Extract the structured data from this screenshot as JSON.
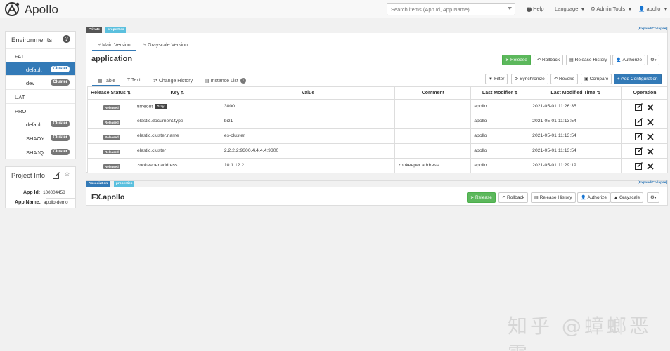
{
  "header": {
    "logo_text": "Apollo",
    "search_placeholder": "Search items (App Id, App Name)",
    "help": "Help",
    "language": "Language",
    "admin_tools": "Admin Tools",
    "user": "apollo"
  },
  "env_panel": {
    "title": "Environments",
    "items": [
      {
        "label": "FAT",
        "badge": ""
      },
      {
        "label": "default",
        "badge": "Cluster"
      },
      {
        "label": "dev",
        "badge": "Cluster"
      },
      {
        "label": "UAT",
        "badge": ""
      },
      {
        "label": "PRO",
        "badge": ""
      },
      {
        "label": "default",
        "badge": "Cluster"
      },
      {
        "label": "SHAOY",
        "badge": "Cluster"
      },
      {
        "label": "SHAJQ",
        "badge": "Cluster"
      }
    ]
  },
  "info_panel": {
    "title": "Project Info",
    "app_id_label": "App Id:",
    "app_id": "100004458",
    "app_name_label": "App Name:",
    "app_name": "apollo-demo"
  },
  "namespace1": {
    "scope_tag": "Private",
    "format_tag": "properties",
    "expand": "[Expand/Collapse]",
    "version_tabs": [
      "Main Version",
      "Grayscale Version"
    ],
    "name": "application",
    "actions": [
      "Release",
      "Rollback",
      "Release History",
      "Authorize"
    ],
    "view_tabs": [
      "Table",
      "Text",
      "Change History",
      "Instance List"
    ],
    "instance_count": "1",
    "table_actions": [
      "Filter",
      "Synchronize",
      "Revoke",
      "Compare",
      "Add Configuration"
    ],
    "columns": [
      "Release Status",
      "Key",
      "Value",
      "Comment",
      "Last Modifier",
      "Last Modified Time",
      "Operation"
    ],
    "rows": [
      {
        "status": "Released",
        "key": "timeout",
        "gray": "Gray",
        "value": "3000",
        "comment": "",
        "modifier": "apollo",
        "time": "2021-05-01 11:26:35"
      },
      {
        "status": "Released",
        "key": "elastic.document.type",
        "gray": "",
        "value": "biz1",
        "comment": "",
        "modifier": "apollo",
        "time": "2021-05-01 11:13:54"
      },
      {
        "status": "Released",
        "key": "elastic.cluster.name",
        "gray": "",
        "value": "es-cluster",
        "comment": "",
        "modifier": "apollo",
        "time": "2021-05-01 11:13:54"
      },
      {
        "status": "Released",
        "key": "elastic.cluster",
        "gray": "",
        "value": "2.2.2.2:9300,4.4.4.4:9300",
        "comment": "",
        "modifier": "apollo",
        "time": "2021-05-01 11:13:54"
      },
      {
        "status": "Released",
        "key": "zookeeper.address",
        "gray": "",
        "value": "10.1.12.2",
        "comment": "zookeeper address",
        "modifier": "apollo",
        "time": "2021-05-01 11:29:19"
      }
    ]
  },
  "namespace2": {
    "scope_tag": "Association",
    "format_tag": "properties",
    "expand": "[Expand/Collapse]",
    "name": "FX.apollo",
    "actions": [
      "Release",
      "Rollback",
      "Release History",
      "Authorize",
      "Grayscale"
    ]
  },
  "watermark": "知乎 @蟑螂恶霸",
  "colors": {
    "primary": "#337ab7",
    "success": "#5cb85c",
    "info": "#5bc0de",
    "muted": "#777777"
  }
}
